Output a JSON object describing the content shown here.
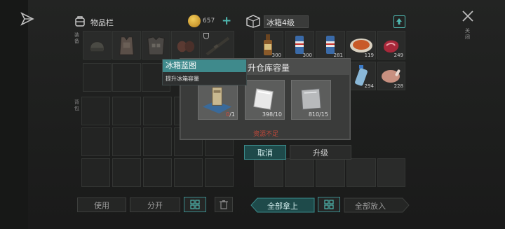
{
  "inventory": {
    "title": "物品栏",
    "coins": "657",
    "add_symbol": "+",
    "equip_section_label": "装备",
    "backpack_section_label": "背包"
  },
  "fridge": {
    "title": "冰箱4级",
    "close_label": "关闭",
    "items": [
      {
        "icon": "vodka-bottle-icon",
        "count": "300",
        "color": "#8a5a2a"
      },
      {
        "icon": "soda-can-icon",
        "count": "300",
        "color": "#3a6aa8"
      },
      {
        "icon": "soda-can-icon",
        "count": "281",
        "color": "#3a6aa8"
      },
      {
        "icon": "pasta-plate-icon",
        "count": "119",
        "color": "#c85a28"
      },
      {
        "icon": "raw-meat-icon",
        "count": "249",
        "color": "#a8283a"
      },
      {
        "icon": "water-bottle-icon",
        "count": "294",
        "color": "#8ab8d8"
      },
      {
        "icon": "roast-chicken-icon",
        "count": "228",
        "color": "#c89080"
      }
    ]
  },
  "modal": {
    "title": "升仓库容量",
    "materials": [
      {
        "icon": "fridge-blueprint-icon",
        "count_have": "0",
        "count_need": "/1"
      },
      {
        "icon": "metal-sheet-icon",
        "count": "398/10"
      },
      {
        "icon": "steel-plate-icon",
        "count": "810/15"
      }
    ],
    "warning": "资源不足",
    "cancel_label": "取消",
    "upgrade_label": "升级"
  },
  "tooltip": {
    "title": "冰箱蓝图",
    "description": "提升冰箱容量"
  },
  "bottom": {
    "use_label": "使用",
    "split_label": "分开",
    "take_all_label": "全部拿上",
    "put_all_label": "全部放入"
  },
  "colors": {
    "accent_teal": "#3f8a8c",
    "warning_red": "#c0483a",
    "coin_gold": "#d4a030"
  }
}
